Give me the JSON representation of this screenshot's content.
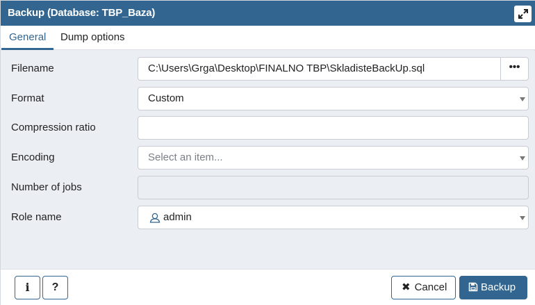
{
  "window": {
    "title": "Backup (Database: TBP_Baza)",
    "maximize_icon": "expand-arrows-icon"
  },
  "tabs": [
    {
      "label": "General",
      "active": true
    },
    {
      "label": "Dump options",
      "active": false
    }
  ],
  "fields": {
    "filename": {
      "label": "Filename",
      "value": "C:\\Users\\Grga\\Desktop\\FINALNO TBP\\SkladisteBackUp.sql",
      "browse_label": "•••"
    },
    "format": {
      "label": "Format",
      "value": "Custom"
    },
    "compression_ratio": {
      "label": "Compression ratio",
      "value": ""
    },
    "encoding": {
      "label": "Encoding",
      "placeholder": "Select an item..."
    },
    "number_of_jobs": {
      "label": "Number of jobs",
      "value": ""
    },
    "role_name": {
      "label": "Role name",
      "value": "admin",
      "icon": "user-icon"
    }
  },
  "footer": {
    "info_label": "i",
    "help_label": "?",
    "cancel_label": "Cancel",
    "backup_label": "Backup"
  },
  "colors": {
    "accent": "#326690",
    "background": "#ebeef3",
    "border": "#c8ccd3"
  }
}
